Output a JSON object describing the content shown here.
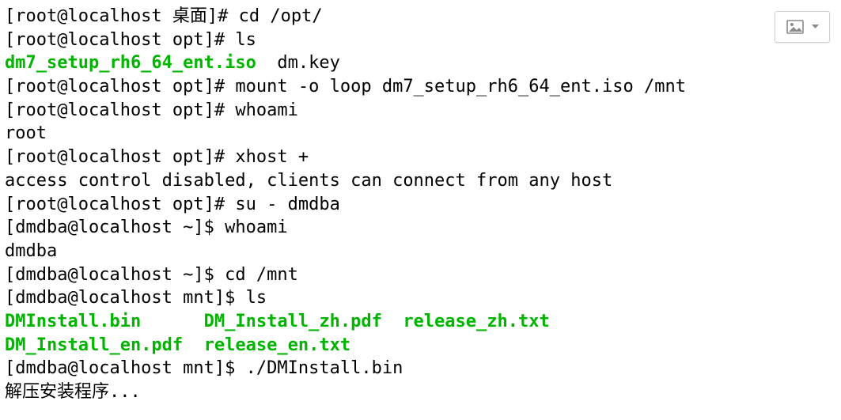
{
  "lines": [
    {
      "segments": [
        {
          "text": "[root@localhost 桌面]# cd /opt/",
          "color": "black"
        }
      ]
    },
    {
      "segments": [
        {
          "text": "[root@localhost opt]# ls",
          "color": "black"
        }
      ]
    },
    {
      "segments": [
        {
          "text": "dm7_setup_rh6_64_ent.iso",
          "color": "green"
        },
        {
          "text": "  dm.key",
          "color": "black"
        }
      ]
    },
    {
      "segments": [
        {
          "text": "[root@localhost opt]# mount -o loop dm7_setup_rh6_64_ent.iso /mnt",
          "color": "black"
        }
      ]
    },
    {
      "segments": [
        {
          "text": "[root@localhost opt]# whoami",
          "color": "black"
        }
      ]
    },
    {
      "segments": [
        {
          "text": "root",
          "color": "black"
        }
      ]
    },
    {
      "segments": [
        {
          "text": "[root@localhost opt]# xhost +",
          "color": "black"
        }
      ]
    },
    {
      "segments": [
        {
          "text": "access control disabled, clients can connect from any host",
          "color": "black"
        }
      ]
    },
    {
      "segments": [
        {
          "text": "[root@localhost opt]# su - dmdba",
          "color": "black"
        }
      ]
    },
    {
      "segments": [
        {
          "text": "[dmdba@localhost ~]$ whoami",
          "color": "black"
        }
      ]
    },
    {
      "segments": [
        {
          "text": "dmdba",
          "color": "black"
        }
      ]
    },
    {
      "segments": [
        {
          "text": "[dmdba@localhost ~]$ cd /mnt",
          "color": "black"
        }
      ]
    },
    {
      "segments": [
        {
          "text": "[dmdba@localhost mnt]$ ls",
          "color": "black"
        }
      ]
    },
    {
      "segments": [
        {
          "text": "DMInstall.bin      DM_Install_zh.pdf  release_zh.txt",
          "color": "green"
        }
      ]
    },
    {
      "segments": [
        {
          "text": "DM_Install_en.pdf  release_en.txt",
          "color": "green"
        }
      ]
    },
    {
      "segments": [
        {
          "text": "[dmdba@localhost mnt]$ ./DMInstall.bin",
          "color": "black"
        }
      ]
    },
    {
      "segments": [
        {
          "text": "解压安装程序...",
          "color": "black"
        }
      ]
    }
  ]
}
